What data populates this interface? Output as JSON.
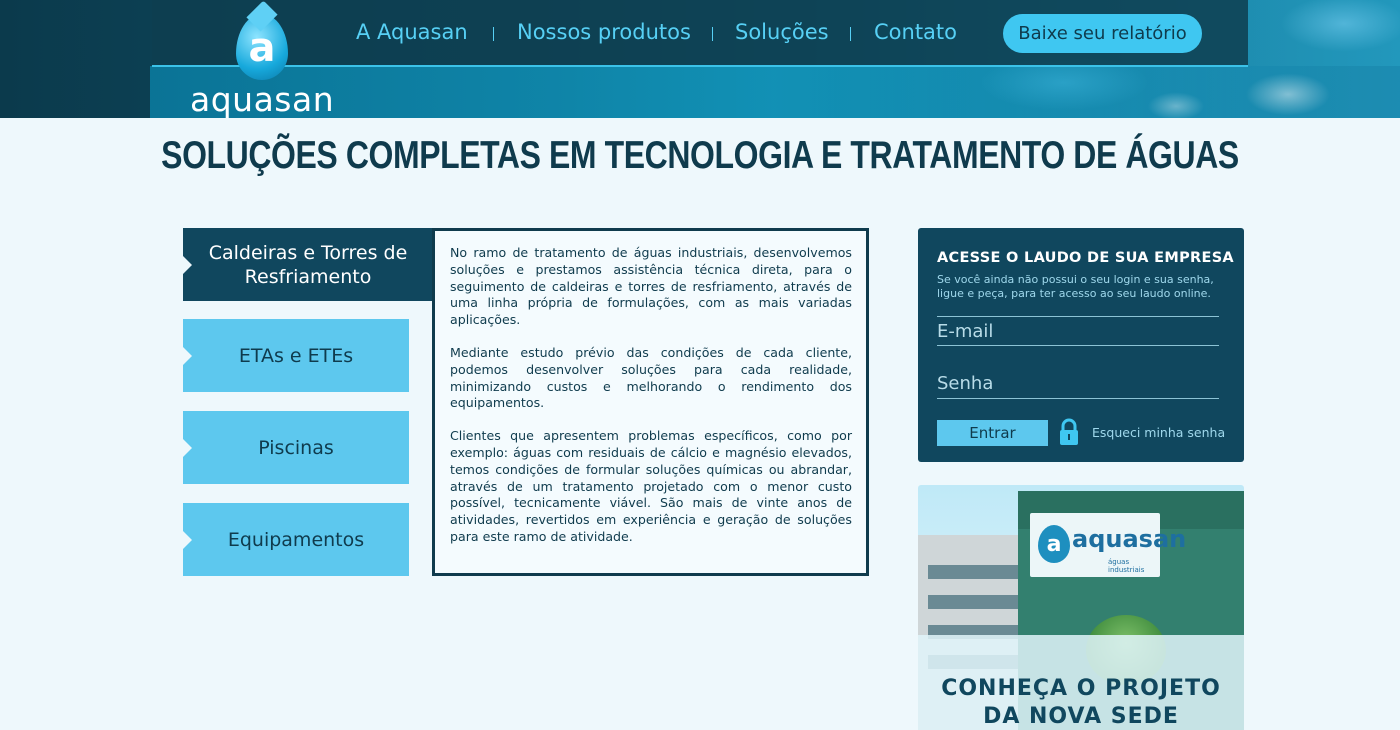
{
  "header": {
    "logo_letter": "a",
    "logo_text": "aquasan",
    "nav": [
      {
        "label": "A Aquasan"
      },
      {
        "label": "Nossos produtos"
      },
      {
        "label": "Soluções"
      },
      {
        "label": "Contato"
      }
    ],
    "cta_label": "Baixe seu relatório"
  },
  "headline": "SOLUÇÕES COMPLETAS EM TECNOLOGIA E TRATAMENTO DE ÁGUAS",
  "tabs": [
    {
      "label": "Caldeiras e Torres de Resfriamento",
      "active": true
    },
    {
      "label": "ETAs e ETEs",
      "active": false
    },
    {
      "label": "Piscinas",
      "active": false
    },
    {
      "label": "Equipamentos",
      "active": false
    }
  ],
  "content": {
    "paragraphs": [
      "No ramo de tratamento de águas industriais, desenvolvemos soluções e prestamos assistência técnica direta, para o seguimento de caldeiras e torres de resfriamento, através de uma linha própria de formulações, com as mais variadas aplicações.",
      "Mediante estudo prévio das condições de cada cliente, podemos desenvolver soluções para cada realidade, minimizando custos e melhorando o rendimento dos equipamentos.",
      "Clientes que apresentem problemas específicos, como por exemplo: águas com residuais de cálcio e magnésio elevados, temos condições de formular soluções químicas ou abrandar, através de um tratamento projetado com o menor custo possível, tecnicamente viável. São mais de vinte anos de atividades, revertidos em experiência e geração de soluções para este ramo de atividade."
    ]
  },
  "login": {
    "title": "ACESSE O LAUDO DE SUA EMPRESA",
    "subtitle": "Se você ainda não possui o seu login e sua senha, ligue e peça, para ter acesso ao seu laudo online.",
    "email_placeholder": "E-mail",
    "password_placeholder": "Senha",
    "submit_label": "Entrar",
    "forgot_label": "Esqueci minha senha",
    "lock_icon": "lock-icon"
  },
  "promo": {
    "sign_letter": "a",
    "sign_word": "aquasan",
    "sign_sub": "águas industriais",
    "title_line1": "CONHEÇA O PROJETO",
    "title_line2": "DA NOVA SEDE"
  },
  "colors": {
    "dark_teal": "#10475e",
    "accent_blue": "#5dc8ee",
    "nav_text": "#57d0f5",
    "background": "#eef8fc"
  }
}
